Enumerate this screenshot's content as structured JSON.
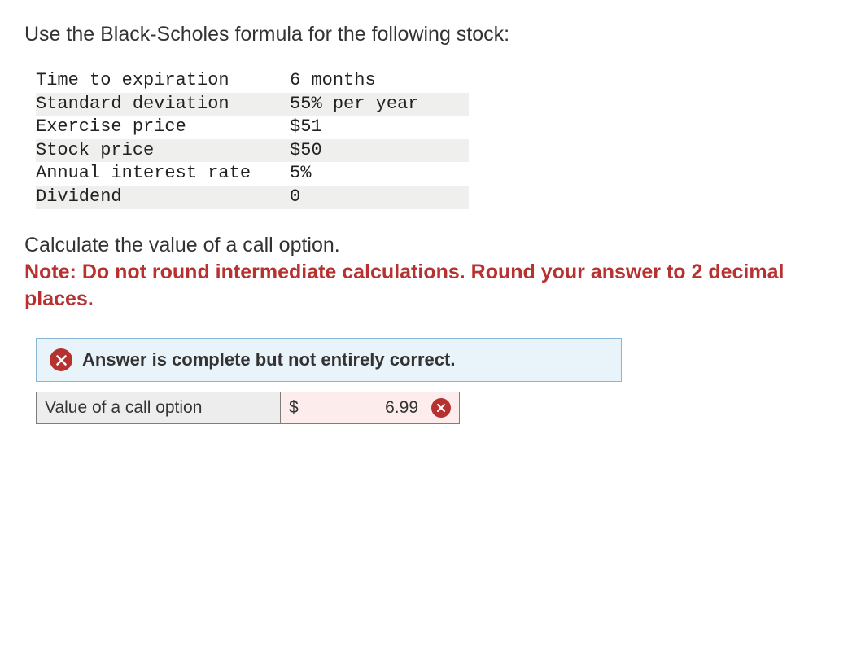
{
  "intro": "Use the Black-Scholes formula for the following stock:",
  "parameters": [
    {
      "label": "Time to expiration",
      "value": "6 months",
      "shaded": false
    },
    {
      "label": "Standard deviation",
      "value": "55% per year",
      "shaded": true
    },
    {
      "label": "Exercise price",
      "value": "$51",
      "shaded": false
    },
    {
      "label": "Stock price",
      "value": "$50",
      "shaded": true
    },
    {
      "label": "Annual interest rate",
      "value": "5%",
      "shaded": false
    },
    {
      "label": "Dividend",
      "value": "0",
      "shaded": true
    }
  ],
  "prompt": "Calculate the value of a call option.",
  "note": "Note: Do not round intermediate calculations. Round your answer to 2 decimal places.",
  "feedback": {
    "message": "Answer is complete but not entirely correct."
  },
  "answer": {
    "label": "Value of a call option",
    "currency": "$",
    "value": "6.99",
    "correct": false
  }
}
